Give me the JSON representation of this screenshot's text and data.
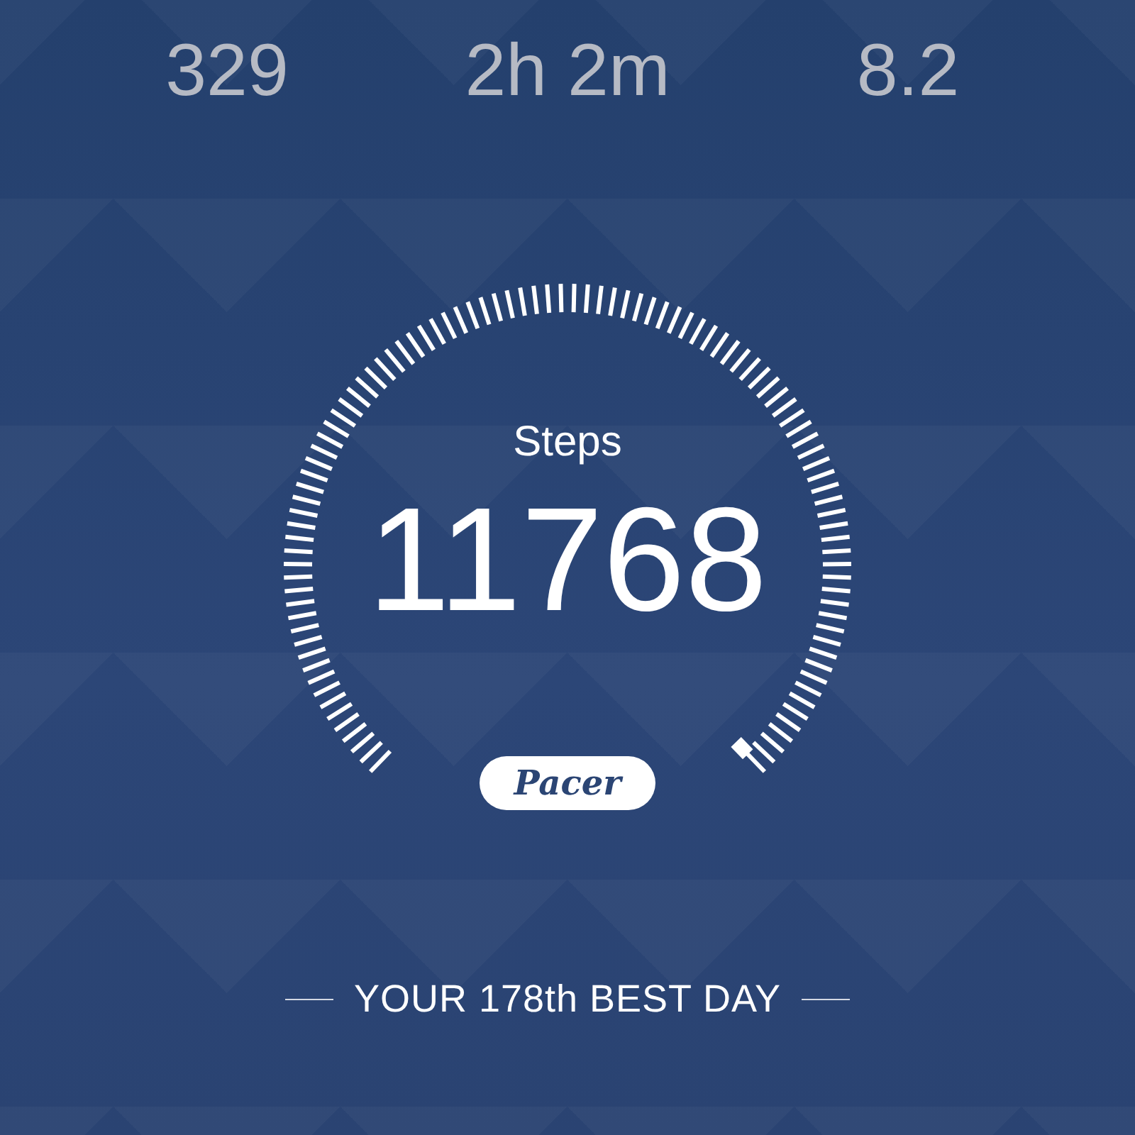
{
  "stats": [
    {
      "value": "329"
    },
    {
      "value": "2h 2m"
    },
    {
      "value": "8.2"
    }
  ],
  "gauge": {
    "label": "Steps",
    "value": "11768"
  },
  "brand": "Pacer",
  "footer": "YOUR 178th BEST DAY"
}
